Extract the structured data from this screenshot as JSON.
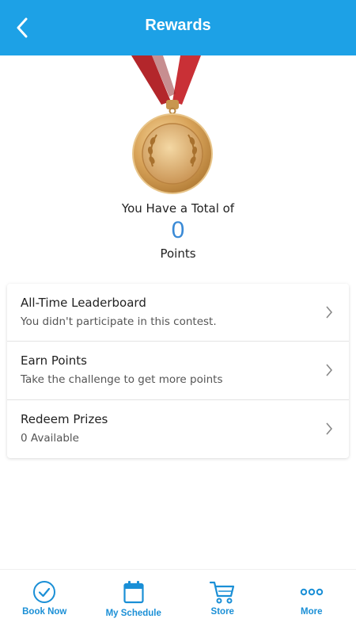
{
  "header": {
    "title": "Rewards"
  },
  "summary": {
    "label": "You Have a Total of",
    "points": "0",
    "unit": "Points"
  },
  "menu": [
    {
      "title": "All-Time Leaderboard",
      "subtitle": "You didn't participate in this contest."
    },
    {
      "title": "Earn Points",
      "subtitle": "Take the challenge to get more points"
    },
    {
      "title": "Redeem Prizes",
      "subtitle": "0 Available"
    }
  ],
  "tabs": [
    {
      "label": "Book Now",
      "icon": "check-circle-icon"
    },
    {
      "label": "My Schedule",
      "icon": "calendar-icon"
    },
    {
      "label": "Store",
      "icon": "cart-icon"
    },
    {
      "label": "More",
      "icon": "more-dots-icon"
    }
  ],
  "colors": {
    "header": "#1da1e6",
    "accent": "#1a8fd6",
    "points": "#3a8ad6"
  }
}
